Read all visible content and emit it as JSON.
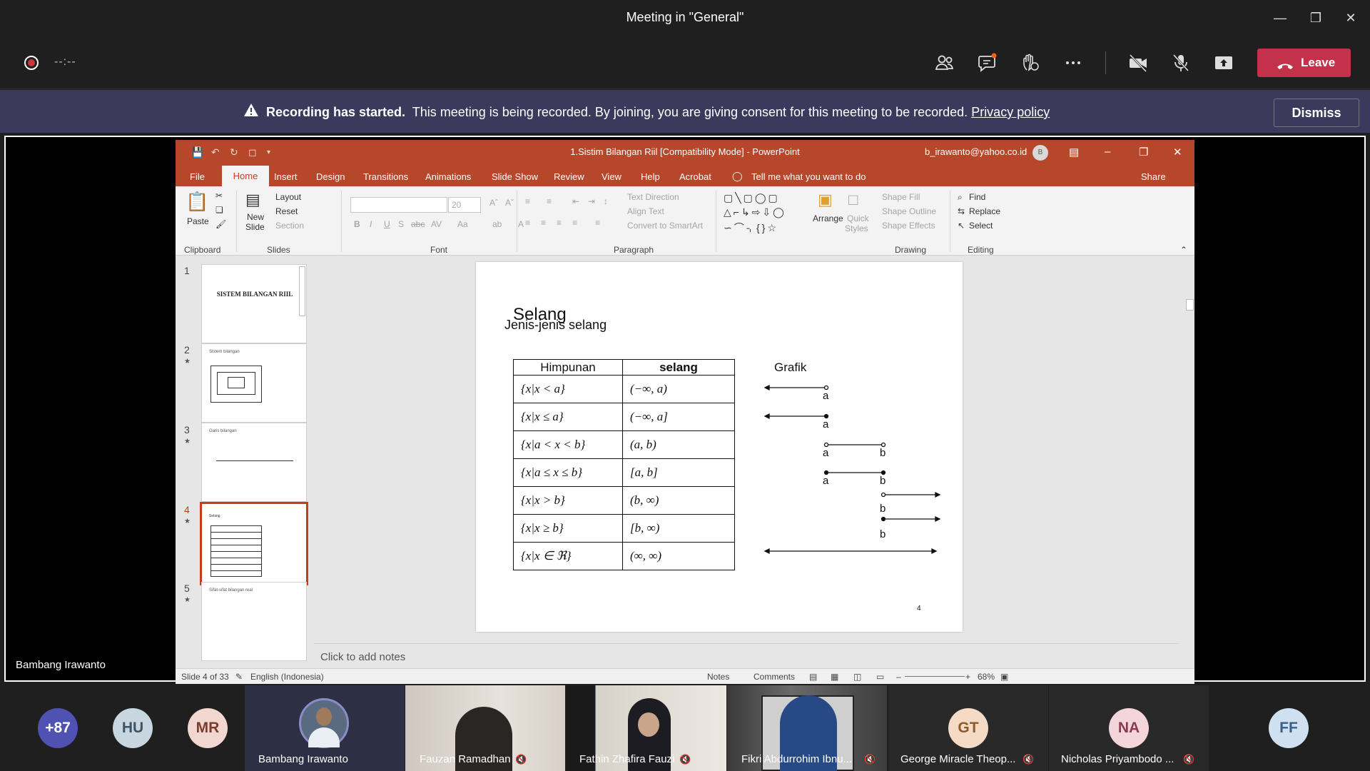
{
  "window": {
    "title": "Meeting in \"General\""
  },
  "controls": {
    "rec_time": "--:--",
    "leave_label": "Leave"
  },
  "banner": {
    "title": "Recording has started.",
    "message": "This meeting is being recorded. By joining, you are giving consent for this meeting to be recorded.",
    "policy_link": "Privacy policy",
    "dismiss_label": "Dismiss"
  },
  "presenter": {
    "name": "Bambang Irawanto"
  },
  "ppt": {
    "window_title": "1.Sistim Bilangan Riil [Compatibility Mode] - PowerPoint",
    "user": "b_irawanto@yahoo.co.id",
    "user_initial": "B",
    "tabs": [
      "File",
      "Home",
      "Insert",
      "Design",
      "Transitions",
      "Animations",
      "Slide Show",
      "Review",
      "View",
      "Help",
      "Acrobat"
    ],
    "tell_me": "Tell me what you want to do",
    "share": "Share",
    "ribbon": {
      "paste": "Paste",
      "new_slide_1": "New",
      "new_slide_2": "Slide",
      "layout": "Layout",
      "reset": "Reset",
      "section": "Section",
      "font_size": "20",
      "text_direction": "Text Direction",
      "align_text": "Align Text",
      "convert_smartart": "Convert to SmartArt",
      "arrange": "Arrange",
      "quick_styles_1": "Quick",
      "quick_styles_2": "Styles",
      "shape_fill": "Shape Fill",
      "shape_outline": "Shape Outline",
      "shape_effects": "Shape Effects",
      "find": "Find",
      "replace": "Replace",
      "select": "Select",
      "groups": {
        "clipboard": "Clipboard",
        "slides": "Slides",
        "font": "Font",
        "paragraph": "Paragraph",
        "drawing": "Drawing",
        "editing": "Editing"
      }
    },
    "thumbs": [
      {
        "num": "1",
        "text": "SISTEM BILANGAN RIIL"
      },
      {
        "num": "2",
        "text": "Sistem bilangan"
      },
      {
        "num": "3",
        "text": "Garis bilangan"
      },
      {
        "num": "4",
        "text": "Selang"
      },
      {
        "num": "5",
        "text": "Sifat-sifat bilangan real"
      }
    ],
    "slide": {
      "title": "Selang",
      "subtitle": "Jenis-jenis selang",
      "col1": "Himpunan",
      "col2": "selang",
      "grafik": "Grafik",
      "rows": [
        [
          "{x|x < a}",
          "(−∞, a)"
        ],
        [
          "{x|x ≤ a}",
          "(−∞, a]"
        ],
        [
          "{x|a < x < b}",
          "(a, b)"
        ],
        [
          "{x|a ≤ x ≤ b}",
          "[a, b]"
        ],
        [
          "{x|x > b}",
          "(b, ∞)"
        ],
        [
          "{x|x ≥ b}",
          "[b, ∞)"
        ],
        [
          "{x|x ∈ ℜ}",
          "(∞, ∞)"
        ]
      ],
      "labels": {
        "a": "a",
        "b": "b"
      },
      "page_num": "4"
    },
    "notes": "Click to add notes",
    "status": {
      "slide": "Slide 4 of 33",
      "language": "English (Indonesia)",
      "notes": "Notes",
      "comments": "Comments",
      "zoom": "68%"
    }
  },
  "gallery": {
    "overflow": "+87",
    "participants": [
      {
        "initials": "HU",
        "color": "#c7d6df"
      },
      {
        "initials": "MR",
        "color": "#f2d6d0"
      },
      {
        "name": "Bambang Irawanto"
      },
      {
        "name": "Fauzan Ramadhan"
      },
      {
        "name": "Fathin Zhafira Fauzi"
      },
      {
        "name": "Fikri Abdurrohim Ibnu..."
      },
      {
        "initials": "GT",
        "color": "#f5dbc5",
        "name": "George Miracle Theop..."
      },
      {
        "initials": "NA",
        "color": "#f5d5dc",
        "name": "Nicholas Priyambodo ..."
      },
      {
        "initials": "FF",
        "color": "#cfe0f1"
      }
    ]
  }
}
